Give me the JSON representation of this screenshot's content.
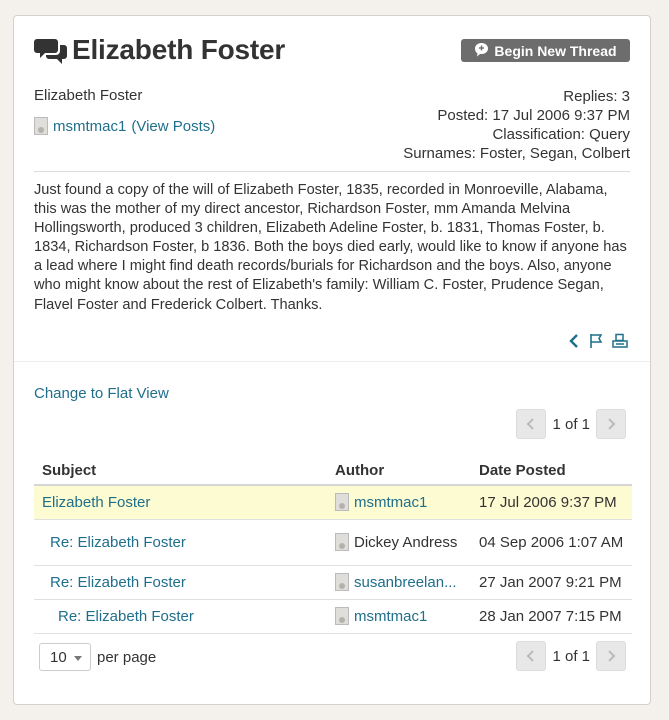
{
  "header": {
    "title": "Elizabeth Foster",
    "begin_button": "Begin New Thread",
    "icon_name": "conversation-icon"
  },
  "post": {
    "name": "Elizabeth Foster",
    "author": "msmtmac1",
    "view_posts": "(View Posts)",
    "replies": "Replies: 3",
    "posted": "Posted: 17 Jul 2006 9:37 PM",
    "classification": "Classification: Query",
    "surnames": "Surnames: Foster, Segan, Colbert",
    "body": "Just found a copy of the will of Elizabeth Foster, 1835, recorded in Monroeville, Alabama, this was the mother of my direct ancestor, Richardson Foster, mm Amanda Melvina Hollingsworth, produced 3 children, Elizabeth Adeline Foster, b. 1831, Thomas Foster, b. 1834, Richardson Foster, b 1836.  Both the boys died early, would like to know if anyone has a lead where I might find death records/burials for Richardson and the boys.  Also, anyone who might know about the rest of Elizabeth's family:  William C. Foster, Prudence Segan, Flavel Foster and Frederick Colbert.  Thanks."
  },
  "view": {
    "flat_link": "Change to Flat View"
  },
  "pager": {
    "text": "1 of 1"
  },
  "table": {
    "headers": [
      "Subject",
      "Author",
      "Date Posted"
    ],
    "rows": [
      {
        "subject": "Elizabeth Foster",
        "author": "msmtmac1",
        "date": "17 Jul 2006 9:37 PM"
      },
      {
        "subject": "Re: Elizabeth Foster",
        "author": "Dickey Andress",
        "date": "04 Sep 2006 1:07 AM"
      },
      {
        "subject": "Re: Elizabeth Foster",
        "author": "susanbreelan...",
        "date": "27 Jan 2007 9:21 PM"
      },
      {
        "subject": "Re: Elizabeth Foster",
        "author": "msmtmac1",
        "date": "28 Jan 2007 7:15 PM"
      }
    ]
  },
  "footer": {
    "per_page_value": "10",
    "per_page_label": "per page"
  },
  "colors": {
    "link": "#1f6f8b",
    "highlight_row": "#fdfbd1",
    "button_bg": "#6d6d6d"
  }
}
